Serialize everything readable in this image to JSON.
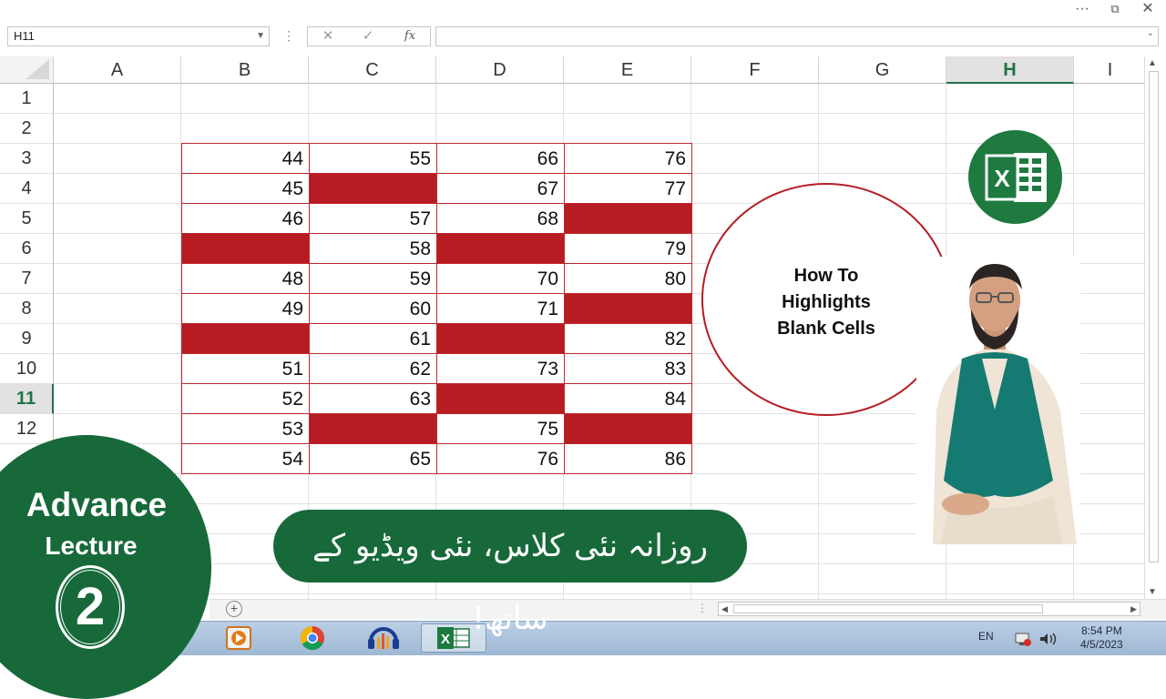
{
  "window": {
    "controls": {
      "more": "···",
      "restore": "⧉",
      "close": "✕"
    }
  },
  "formula_bar": {
    "name_box": "H11",
    "cancel_glyph": "✕",
    "enter_glyph": "✓",
    "fx_label": "fx",
    "formula": ""
  },
  "columns": [
    "A",
    "B",
    "C",
    "D",
    "E",
    "F",
    "G",
    "H",
    "I"
  ],
  "selected_column": "H",
  "rows": [
    "1",
    "2",
    "3",
    "4",
    "5",
    "6",
    "7",
    "8",
    "9",
    "10",
    "11",
    "12"
  ],
  "selected_row": "11",
  "table": [
    [
      "44",
      "55",
      "66",
      "76"
    ],
    [
      "45",
      "",
      "67",
      "77"
    ],
    [
      "46",
      "57",
      "68",
      ""
    ],
    [
      "",
      "58",
      "",
      "79"
    ],
    [
      "48",
      "59",
      "70",
      "80"
    ],
    [
      "49",
      "60",
      "71",
      ""
    ],
    [
      "",
      "61",
      "",
      "82"
    ],
    [
      "51",
      "62",
      "73",
      "83"
    ],
    [
      "52",
      "63",
      "",
      "84"
    ],
    [
      "53",
      "",
      "75",
      ""
    ],
    [
      "54",
      "65",
      "76",
      "86"
    ]
  ],
  "highlight_color": "#b71c22",
  "accent_color": "#217346",
  "title_circle": {
    "lines": [
      "How To",
      "Highlights",
      "Blank Cells"
    ]
  },
  "badge": {
    "line1": "Advance",
    "line2": "Lecture",
    "number": "2"
  },
  "banner": {
    "text": "روزانہ نئی کلاس، نئی ویڈیو کے ساتھ!"
  },
  "excel_logo": {
    "letter": "X"
  },
  "taskbar": {
    "apps": [
      "media-player",
      "chrome",
      "audio-editor",
      "excel"
    ],
    "language": "EN",
    "time": "8:54 PM",
    "date": "4/5/2023"
  }
}
